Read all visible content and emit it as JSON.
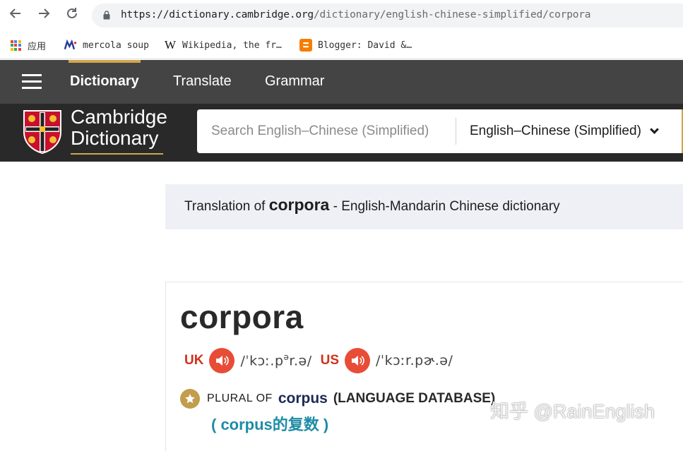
{
  "browser": {
    "url_main": "https://dictionary.cambridge.org",
    "url_path": "/dictionary/english-chinese-simplified/corpora",
    "bookmarks": [
      {
        "label": "应用",
        "icon": "apps-grid-icon"
      },
      {
        "label": "mercola soup",
        "icon": "mercola-icon"
      },
      {
        "label": "Wikipedia, the fr…",
        "icon": "wikipedia-icon"
      },
      {
        "label": "Blogger: David &…",
        "icon": "blogger-icon"
      }
    ]
  },
  "header": {
    "tabs": [
      "Dictionary",
      "Translate",
      "Grammar"
    ],
    "brand_line1": "Cambridge",
    "brand_line2": "Dictionary",
    "search_placeholder": "Search English–Chinese (Simplified)",
    "language": "English–Chinese (Simplified)"
  },
  "translation": {
    "prefix": "Translation of ",
    "word": "corpora",
    "suffix": " - English-Mandarin Chinese dictionary"
  },
  "entry": {
    "headword": "corpora",
    "uk_label": "UK",
    "uk_ipa_a": "/ˈkɔː.p",
    "uk_ipa_sup": "ə",
    "uk_ipa_b": "r.ə/",
    "us_label": "US",
    "us_ipa": "/ˈkɔːr.pɚ.ə/",
    "plural_label": "PLURAL OF",
    "plural_word": "corpus",
    "guide_word": "(LANGUAGE DATABASE)",
    "zh_translation": "( corpus的复数 )"
  },
  "watermark": "知乎 @RainEnglish",
  "colors": {
    "nav_bg": "#444444",
    "brand_bg": "#292929",
    "accent_gold": "#d0a44c",
    "audio_red": "#e94c36",
    "region_red": "#d0311d",
    "zh_teal": "#1e8ca6",
    "plural_navy": "#1d2a57"
  }
}
